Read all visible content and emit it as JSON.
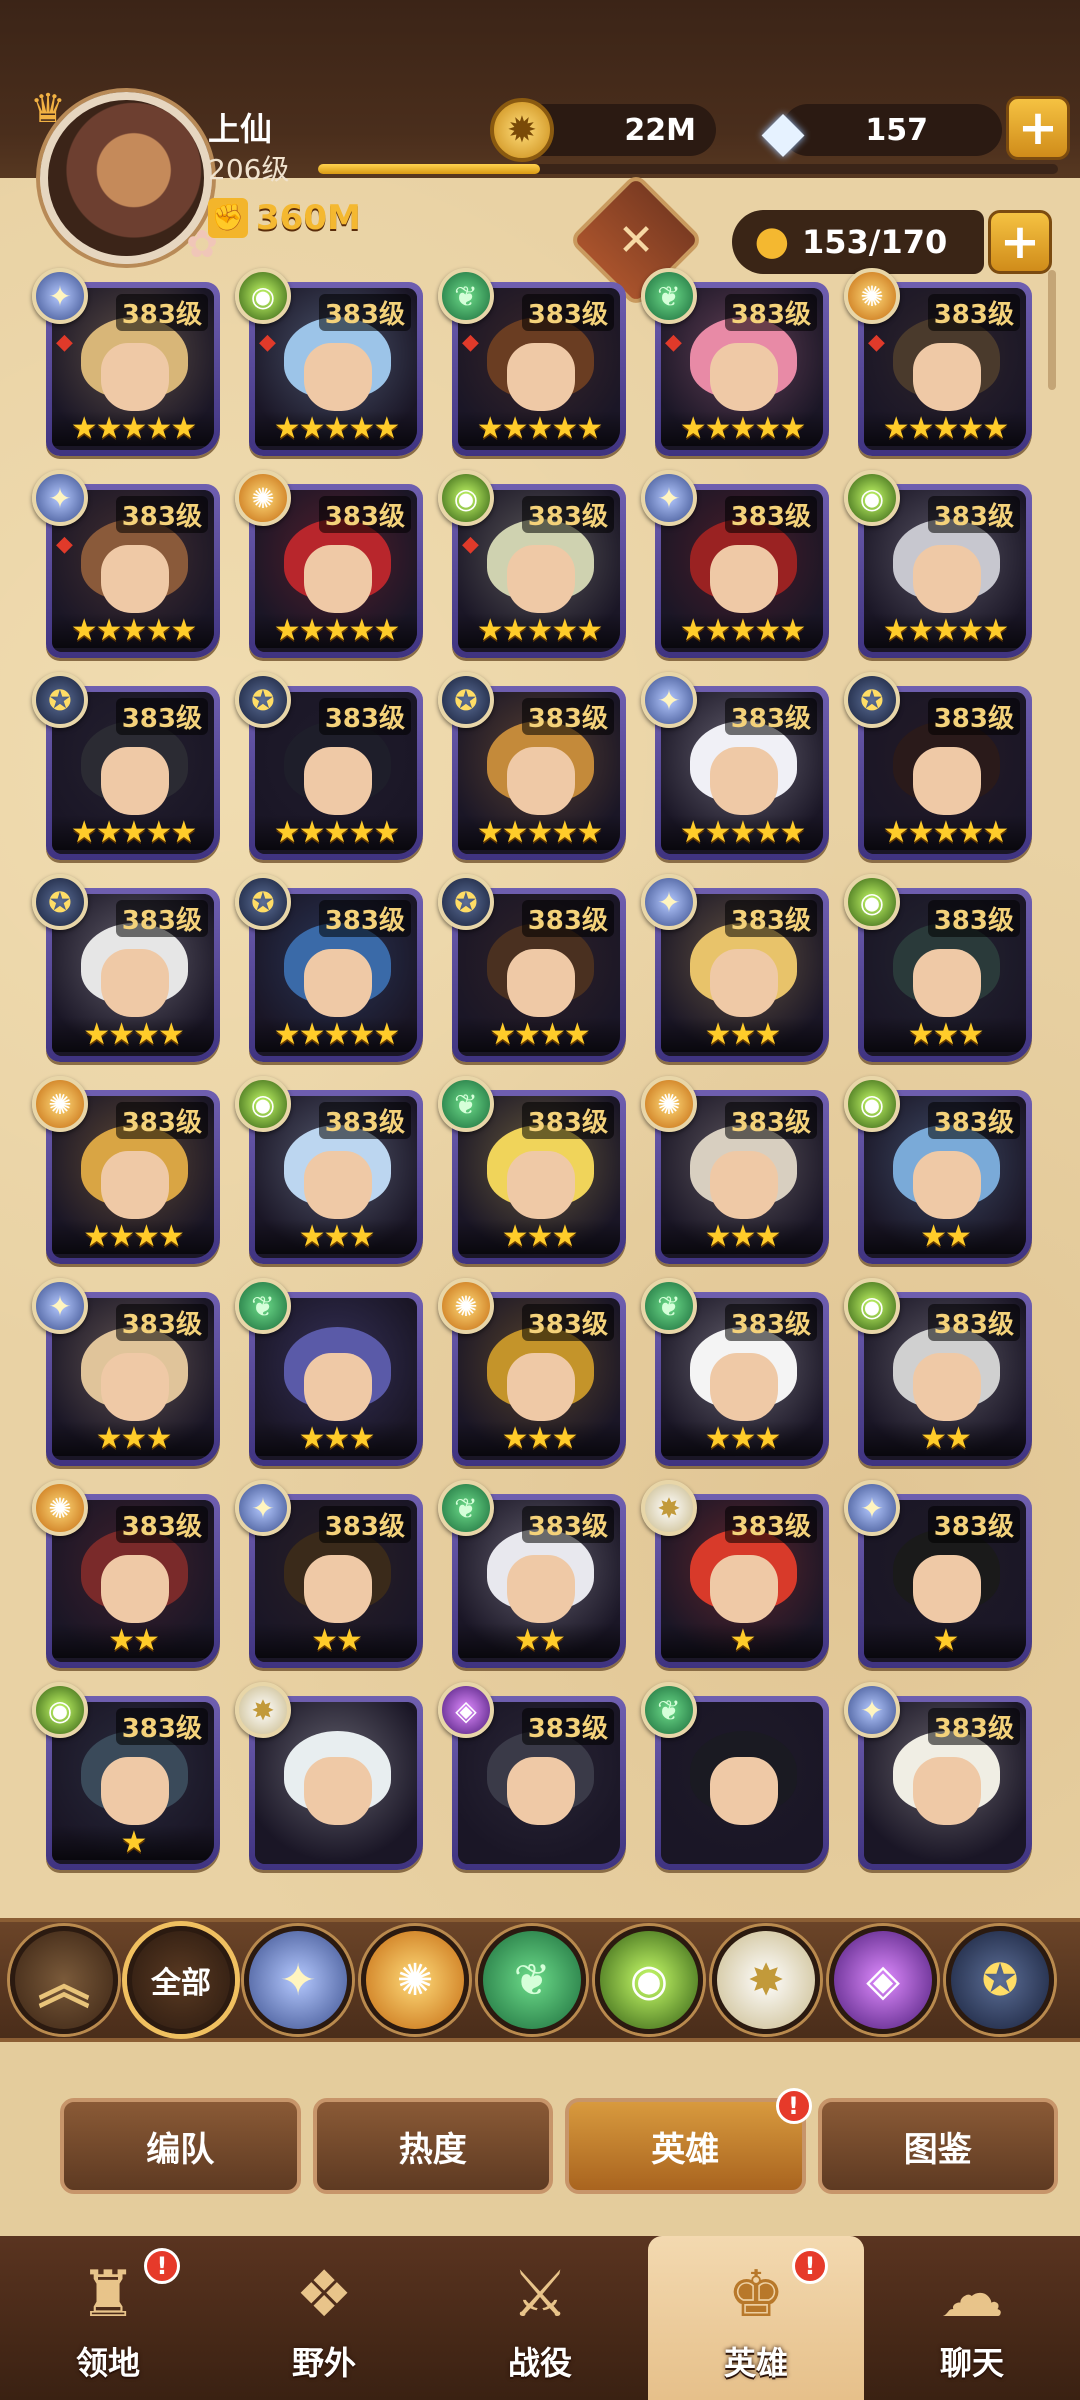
{
  "player": {
    "name": "上仙",
    "level": "206级",
    "power": "360M",
    "xp_progress": 0.3
  },
  "resources": {
    "gold": "22M",
    "diamonds": "157"
  },
  "roster": {
    "count": "153/170"
  },
  "heroes": [
    {
      "faction": "celestial",
      "level": "383级",
      "stars": "★★★★★",
      "gem": true,
      "hair": "#d8b678"
    },
    {
      "faction": "wilder",
      "level": "383级",
      "stars": "★★★★★",
      "gem": true,
      "hair": "#9cc4e8"
    },
    {
      "faction": "maulers",
      "level": "383级",
      "stars": "★★★★★",
      "gem": true,
      "hair": "#6a3d22"
    },
    {
      "faction": "maulers",
      "level": "383级",
      "stars": "★★★★★",
      "gem": true,
      "hair": "#e88aa6"
    },
    {
      "faction": "lightbearer",
      "level": "383级",
      "stars": "★★★★★",
      "gem": true,
      "hair": "#4a3a2c"
    },
    {
      "faction": "celestial",
      "level": "383级",
      "stars": "★★★★★",
      "gem": true,
      "hair": "#8a5a3a"
    },
    {
      "faction": "lightbearer",
      "level": "383级",
      "stars": "★★★★★",
      "gem": false,
      "hair": "#b8262c"
    },
    {
      "faction": "wilder",
      "level": "383级",
      "stars": "★★★★★",
      "gem": true,
      "hair": "#cfd2b0"
    },
    {
      "faction": "celestial",
      "level": "383级",
      "stars": "★★★★★",
      "gem": false,
      "hair": "#9a2222"
    },
    {
      "faction": "wilder",
      "level": "383级",
      "stars": "★★★★★",
      "gem": false,
      "hair": "#c7c7cf"
    },
    {
      "faction": "graveborn",
      "level": "383级",
      "stars": "★★★★★",
      "gem": false,
      "hair": "#2b2b33"
    },
    {
      "faction": "graveborn",
      "level": "383级",
      "stars": "★★★★★",
      "gem": false,
      "hair": "#1e1e2a"
    },
    {
      "faction": "graveborn",
      "level": "383级",
      "stars": "★★★★★",
      "gem": false,
      "hair": "#c48a3a"
    },
    {
      "faction": "celestial",
      "level": "383级",
      "stars": "★★★★★",
      "gem": false,
      "hair": "#f0f0f6"
    },
    {
      "faction": "graveborn",
      "level": "383级",
      "stars": "★★★★★",
      "gem": false,
      "hair": "#2a1a1a"
    },
    {
      "faction": "graveborn",
      "level": "383级",
      "stars": "★★★★",
      "gem": false,
      "hair": "#e6e6e6"
    },
    {
      "faction": "graveborn",
      "level": "383级",
      "stars": "★★★★★",
      "gem": false,
      "hair": "#3a6aa8"
    },
    {
      "faction": "graveborn",
      "level": "383级",
      "stars": "★★★★",
      "gem": false,
      "hair": "#4a3020"
    },
    {
      "faction": "celestial",
      "level": "383级",
      "stars": "★★★",
      "gem": false,
      "hair": "#e8c36a"
    },
    {
      "faction": "wilder",
      "level": "383级",
      "stars": "★★★",
      "gem": false,
      "hair": "#2a3a3a"
    },
    {
      "faction": "lightbearer",
      "level": "383级",
      "stars": "★★★★",
      "gem": false,
      "hair": "#d9a544"
    },
    {
      "faction": "wilder",
      "level": "383级",
      "stars": "★★★",
      "gem": false,
      "hair": "#bcd6f0"
    },
    {
      "faction": "maulers",
      "level": "383级",
      "stars": "★★★",
      "gem": false,
      "hair": "#f0d45a"
    },
    {
      "faction": "lightbearer",
      "level": "383级",
      "stars": "★★★",
      "gem": false,
      "hair": "#d8cfc0"
    },
    {
      "faction": "wilder",
      "level": "383级",
      "stars": "★★",
      "gem": false,
      "hair": "#7aaad8"
    },
    {
      "faction": "celestial",
      "level": "383级",
      "stars": "★★★",
      "gem": false,
      "hair": "#e0c49a"
    },
    {
      "faction": "maulers",
      "level": "",
      "stars": "★★★",
      "gem": false,
      "hair": "#5a5aa8"
    },
    {
      "faction": "lightbearer",
      "level": "383级",
      "stars": "★★★",
      "gem": false,
      "hair": "#c4942a"
    },
    {
      "faction": "maulers",
      "level": "383级",
      "stars": "★★★",
      "gem": false,
      "hair": "#f4f4f4"
    },
    {
      "faction": "wilder",
      "level": "383级",
      "stars": "★★",
      "gem": false,
      "hair": "#d0d0d0"
    },
    {
      "faction": "lightbearer",
      "level": "383级",
      "stars": "★★",
      "gem": false,
      "hair": "#7a2a2a"
    },
    {
      "faction": "celestial",
      "level": "383级",
      "stars": "★★",
      "gem": false,
      "hair": "#3a2a1a"
    },
    {
      "faction": "maulers",
      "level": "383级",
      "stars": "★★",
      "gem": false,
      "hair": "#e8e8ee"
    },
    {
      "faction": "dimensional",
      "level": "383级",
      "stars": "★",
      "gem": false,
      "hair": "#d83a2a"
    },
    {
      "faction": "celestial",
      "level": "383级",
      "stars": "★",
      "gem": false,
      "hair": "#1a1a1a"
    },
    {
      "faction": "wilder",
      "level": "383级",
      "stars": "★",
      "gem": false,
      "hair": "#3a4a5a"
    },
    {
      "faction": "dimensional",
      "level": "",
      "stars": "",
      "gem": false,
      "hair": "#e8eef0"
    },
    {
      "faction": "hypogean",
      "level": "383级",
      "stars": "",
      "gem": false,
      "hair": "#3a3a48"
    },
    {
      "faction": "maulers",
      "level": "",
      "stars": "",
      "gem": false,
      "hair": "#1a1a22"
    },
    {
      "faction": "celestial",
      "level": "383级",
      "stars": "",
      "gem": false,
      "hair": "#f0eee4"
    }
  ],
  "filters": {
    "all_label": "全部"
  },
  "tabs": [
    {
      "label": "编队"
    },
    {
      "label": "热度"
    },
    {
      "label": "英雄",
      "active": true,
      "badge": "!"
    },
    {
      "label": "图鉴"
    }
  ],
  "nav": [
    {
      "label": "领地",
      "icon": "castle-icon",
      "badge": "!"
    },
    {
      "label": "野外",
      "icon": "scroll-map-icon"
    },
    {
      "label": "战役",
      "icon": "sword-shield-icon"
    },
    {
      "label": "英雄",
      "icon": "helmet-icon",
      "active": true,
      "badge": "!"
    },
    {
      "label": "聊天",
      "icon": "chat-bubble-icon"
    }
  ]
}
